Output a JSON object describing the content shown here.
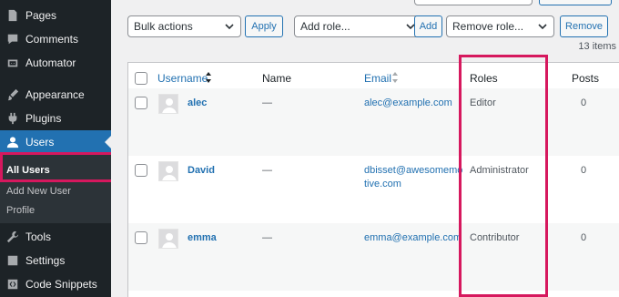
{
  "sidebar": {
    "items": [
      {
        "label": "Pages",
        "icon": "pages-icon"
      },
      {
        "label": "Comments",
        "icon": "comments-icon"
      },
      {
        "label": "Automator",
        "icon": "automator-icon"
      },
      {
        "label": "Appearance",
        "icon": "appearance-icon"
      },
      {
        "label": "Plugins",
        "icon": "plugins-icon"
      },
      {
        "label": "Users",
        "icon": "users-icon"
      },
      {
        "label": "Tools",
        "icon": "tools-icon"
      },
      {
        "label": "Settings",
        "icon": "settings-icon"
      },
      {
        "label": "Code Snippets",
        "icon": "code-snippets-icon"
      }
    ],
    "submenu": {
      "all_users": "All Users",
      "add_new_user": "Add New User",
      "profile": "Profile"
    }
  },
  "toolbar": {
    "bulk_actions": "Bulk actions",
    "apply": "Apply",
    "add_role": "Add role...",
    "add": "Add",
    "remove_role": "Remove role...",
    "remove": "Remove",
    "count": "13 items"
  },
  "table": {
    "headers": {
      "username": "Username",
      "name": "Name",
      "email": "Email",
      "roles": "Roles",
      "posts": "Posts"
    },
    "rows": [
      {
        "username": "alec",
        "name": "—",
        "email": "alec@example.com",
        "role": "Editor",
        "posts": "0"
      },
      {
        "username": "David",
        "name": "—",
        "email": "dbisset@awesomemotive.com",
        "role": "Administrator",
        "posts": "0"
      },
      {
        "username": "emma",
        "name": "—",
        "email": "emma@example.com",
        "role": "Contributor",
        "posts": "0"
      }
    ]
  },
  "colors": {
    "accent": "#2271b1",
    "highlight": "#d6185e",
    "sidebar_bg": "#1d2327"
  }
}
